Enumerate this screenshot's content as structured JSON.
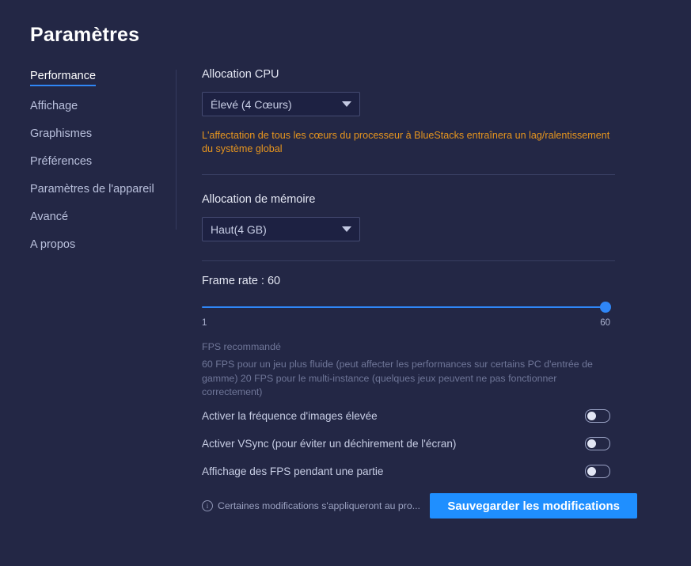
{
  "page": {
    "title": "Paramètres"
  },
  "sidebar": {
    "items": [
      {
        "label": "Performance",
        "active": true
      },
      {
        "label": "Affichage",
        "active": false
      },
      {
        "label": "Graphismes",
        "active": false
      },
      {
        "label": "Préférences",
        "active": false
      },
      {
        "label": "Paramètres de l'appareil",
        "active": false
      },
      {
        "label": "Avancé",
        "active": false
      },
      {
        "label": "A propos",
        "active": false
      }
    ]
  },
  "main": {
    "cpu": {
      "label": "Allocation CPU",
      "value": "Élevé (4 Cœurs)",
      "caret_icon": "chevron-down-icon",
      "warning": "L'affectation de tous les cœurs du processeur à BlueStacks entraînera un lag/ralentissement du système global"
    },
    "memory": {
      "label": "Allocation de mémoire",
      "value": "Haut(4 GB)",
      "caret_icon": "chevron-down-icon"
    },
    "frame_rate": {
      "label": "Frame rate : 60",
      "value": 60,
      "min": 1,
      "max": 60,
      "min_label": "1",
      "max_label": "60",
      "recommendation_title": "FPS recommandé",
      "recommendation_body": "60 FPS pour un jeu plus fluide (peut affecter les performances sur certains PC d'entrée de gamme) 20 FPS pour le multi-instance (quelques jeux peuvent ne pas fonctionner correctement)"
    },
    "toggles": [
      {
        "label": "Activer la fréquence d'images élevée",
        "on": false
      },
      {
        "label": "Activer VSync (pour éviter un déchirement de l'écran)",
        "on": false
      },
      {
        "label": "Affichage des FPS pendant une partie",
        "on": false
      }
    ]
  },
  "footer": {
    "info_icon": "info-icon",
    "note": "Certaines modifications s'appliqueront au pro...",
    "save_label": "Sauvegarder les modifications"
  },
  "colors": {
    "background": "#232745",
    "accent": "#2f86f6",
    "button": "#1f8fff",
    "warning": "#e8961e",
    "muted": "#6f7698"
  }
}
